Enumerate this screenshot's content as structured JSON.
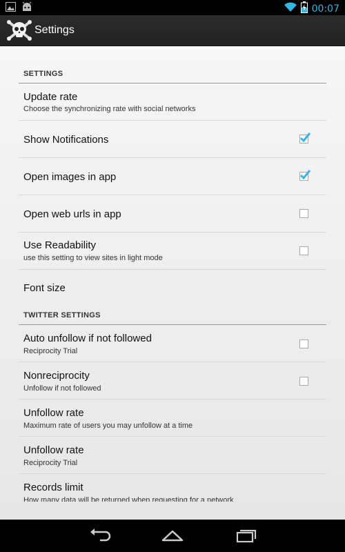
{
  "status_bar": {
    "time": "00:07",
    "left_icons": [
      "image-notification-icon",
      "android-notification-icon"
    ],
    "right_icons": [
      "wifi-icon",
      "battery-charging-icon"
    ]
  },
  "action_bar": {
    "title": "Settings",
    "app_icon": "skull-crossbones-app-icon"
  },
  "sections": {
    "settings": {
      "header": "SETTINGS",
      "items": {
        "update_rate": {
          "title": "Update rate",
          "summary": "Choose the synchronizing rate with social networks"
        },
        "show_notifications": {
          "title": "Show Notifications",
          "checked": true
        },
        "open_images": {
          "title": "Open images in app",
          "checked": true
        },
        "open_web_urls": {
          "title": "Open web urls in app",
          "checked": false
        },
        "use_readability": {
          "title": "Use Readability",
          "summary": "use this setting to view sites in light mode",
          "checked": false
        },
        "font_size": {
          "title": "Font size"
        }
      }
    },
    "twitter": {
      "header": "TWITTER SETTINGS",
      "items": {
        "auto_unfollow": {
          "title": "Auto unfollow if not followed",
          "summary": "Reciprocity Trial",
          "checked": false
        },
        "nonreciprocity": {
          "title": "Nonreciprocity",
          "summary": "Unfollow if not followed",
          "checked": false
        },
        "unfollow_rate_1": {
          "title": "Unfollow rate",
          "summary": "Maximum rate of users you may unfollow at a time"
        },
        "unfollow_rate_2": {
          "title": "Unfollow rate",
          "summary": "Reciprocity Trial"
        },
        "records_limit": {
          "title": "Records limit",
          "summary": "How many data will be returned when requesting for a network"
        }
      }
    }
  },
  "nav_bar": {
    "icons": [
      "back-icon",
      "home-icon",
      "recent-apps-icon"
    ]
  },
  "colors": {
    "accent": "#33b5e5",
    "checkmark": "#33b5e5",
    "background_top": "#f6f6f6",
    "background_bottom": "#e6e6e6"
  }
}
